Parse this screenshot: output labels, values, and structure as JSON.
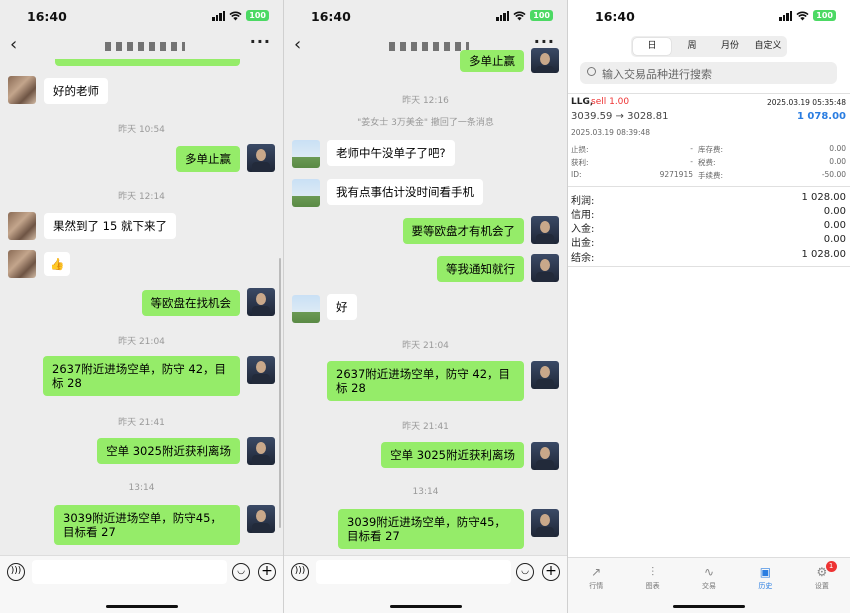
{
  "status": {
    "time": "16:40",
    "battery": "100"
  },
  "p1": {
    "messages": [
      {
        "side": "left",
        "avatar": "pixel",
        "text": "好的老师"
      },
      {
        "ts": "昨天 10:54"
      },
      {
        "side": "right",
        "text": "多单止赢"
      },
      {
        "ts": "昨天 12:14"
      },
      {
        "side": "left",
        "avatar": "pixel",
        "text": "果然到了 15 就下来了"
      },
      {
        "side": "left",
        "avatar": "pixel",
        "text": "👍"
      },
      {
        "side": "right",
        "text": "等欧盘在找机会"
      },
      {
        "ts": "昨天 21:04"
      },
      {
        "side": "right",
        "text": "2637附近进场空单，防守 42，目标 28"
      },
      {
        "ts": "昨天 21:41"
      },
      {
        "side": "right",
        "text": "空单 3025附近获利离场"
      },
      {
        "ts": "13:14"
      },
      {
        "side": "right",
        "text": "3039附近进场空单，防守45，目标看 27"
      }
    ]
  },
  "p2": {
    "top_bubble": "多单止赢",
    "ts1": "昨天 12:16",
    "recall": "\"姜女士 3万美金\" 撤回了一条消息",
    "m1": "老师中午没单子了吧?",
    "m2": "我有点事估计没时间看手机",
    "m3": "要等欧盘才有机会了",
    "m4": "等我通知就行",
    "m5": "好",
    "ts2": "昨天 21:04",
    "m6": "2637附近进场空单，防守 42，目标 28",
    "ts3": "昨天 21:41",
    "m7": "空单 3025附近获利离场",
    "ts4": "13:14",
    "m8": "3039附近进场空单，防守45，目标看 27"
  },
  "p3": {
    "seg": [
      "日",
      "周",
      "月份",
      "自定义"
    ],
    "search_placeholder": "输入交易品种进行搜索",
    "order": {
      "symbol": "LLG,",
      "side": "sell 1.00",
      "datetime": "2025.03.19 05:35:48",
      "prices": "3039.59 → 3028.81",
      "profit": "1 078.00",
      "open_time": "2025.03.19 08:39:48"
    },
    "details_left": [
      {
        "k": "止损:",
        "v": "-"
      },
      {
        "k": "获利:",
        "v": "-"
      },
      {
        "k": "ID:",
        "v": "9271915"
      }
    ],
    "details_right": [
      {
        "k": "库存费:",
        "v": "0.00"
      },
      {
        "k": "税费:",
        "v": "0.00"
      },
      {
        "k": "手续费:",
        "v": "-50.00"
      }
    ],
    "summary": [
      {
        "k": "利润:",
        "v": "1 028.00"
      },
      {
        "k": "信用:",
        "v": "0.00"
      },
      {
        "k": "入金:",
        "v": "0.00"
      },
      {
        "k": "出金:",
        "v": "0.00"
      },
      {
        "k": "结余:",
        "v": "1 028.00"
      }
    ],
    "tabs": [
      {
        "label": "行情",
        "icon": "↗"
      },
      {
        "label": "图表",
        "icon": "⫶"
      },
      {
        "label": "交易",
        "icon": "∿"
      },
      {
        "label": "历史",
        "icon": "▣"
      },
      {
        "label": "设置",
        "icon": "⚙"
      }
    ],
    "badge": "1",
    "accent": "#2a7de1"
  }
}
